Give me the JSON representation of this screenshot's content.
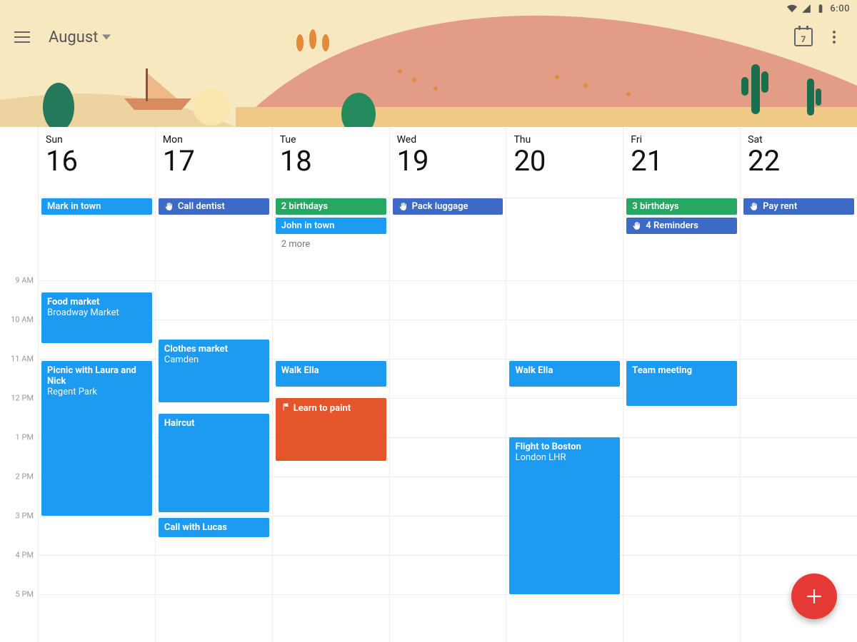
{
  "status": {
    "time": "6:00"
  },
  "toolbar": {
    "month_label": "August",
    "today_number": "7"
  },
  "colors": {
    "blue": "#1d9bf0",
    "navy": "#3d6ac4",
    "green": "#27a762",
    "orange": "#e4552b"
  },
  "hours": {
    "start": 7,
    "pxPerHour": 55,
    "labels": [
      "9 AM",
      "10 AM",
      "11 AM",
      "12 PM",
      "1 PM",
      "2 PM",
      "3 PM",
      "4 PM",
      "5 PM"
    ],
    "labelHours": [
      9,
      10,
      11,
      12,
      13,
      14,
      15,
      16,
      17
    ]
  },
  "days": [
    {
      "dow": "Sun",
      "num": "16",
      "allday": [
        {
          "text": "Mark in town",
          "color": "c-blue"
        }
      ],
      "more": null,
      "events": [
        {
          "title": "Food market",
          "sub": "Broadway Market",
          "start": 9.3,
          "end": 10.6,
          "color": "c-blue"
        },
        {
          "title": "Picnic with Laura and Nick",
          "sub": "Regent Park",
          "start": 11.05,
          "end": 15.0,
          "color": "c-blue"
        }
      ]
    },
    {
      "dow": "Mon",
      "num": "17",
      "allday": [
        {
          "text": "Call dentist",
          "color": "c-navy",
          "icon": "hand"
        }
      ],
      "more": null,
      "events": [
        {
          "title": "Clothes market",
          "sub": "Camden",
          "start": 10.5,
          "end": 12.1,
          "color": "c-blue"
        },
        {
          "title": "Haircut",
          "sub": "",
          "start": 12.4,
          "end": 14.9,
          "color": "c-blue"
        },
        {
          "title": "Call with Lucas",
          "sub": "",
          "start": 15.05,
          "end": 15.55,
          "color": "c-blue"
        }
      ]
    },
    {
      "dow": "Tue",
      "num": "18",
      "allday": [
        {
          "text": "2 birthdays",
          "color": "c-green"
        },
        {
          "text": "John in town",
          "color": "c-blue"
        }
      ],
      "more": "2 more",
      "events": [
        {
          "title": "Walk Ella",
          "sub": "",
          "start": 11.05,
          "end": 11.7,
          "color": "c-blue"
        },
        {
          "title": "Learn to paint",
          "sub": "",
          "start": 12.0,
          "end": 13.6,
          "color": "c-orange",
          "goal": true
        }
      ]
    },
    {
      "dow": "Wed",
      "num": "19",
      "allday": [
        {
          "text": "Pack luggage",
          "color": "c-navy",
          "icon": "hand"
        }
      ],
      "more": null,
      "events": []
    },
    {
      "dow": "Thu",
      "num": "20",
      "allday": [],
      "more": null,
      "events": [
        {
          "title": "Walk Ella",
          "sub": "",
          "start": 11.05,
          "end": 11.7,
          "color": "c-blue"
        },
        {
          "title": "Flight to Boston",
          "sub": "London LHR",
          "start": 13.0,
          "end": 17.0,
          "color": "c-blue"
        }
      ]
    },
    {
      "dow": "Fri",
      "num": "21",
      "allday": [
        {
          "text": "3 birthdays",
          "color": "c-green"
        },
        {
          "text": "4 Reminders",
          "color": "c-navy",
          "icon": "hand"
        }
      ],
      "more": null,
      "events": [
        {
          "title": "Team meeting",
          "sub": "",
          "start": 11.05,
          "end": 12.2,
          "color": "c-blue"
        }
      ]
    },
    {
      "dow": "Sat",
      "num": "22",
      "allday": [
        {
          "text": "Pay rent",
          "color": "c-navy",
          "icon": "hand"
        }
      ],
      "more": null,
      "events": []
    }
  ]
}
